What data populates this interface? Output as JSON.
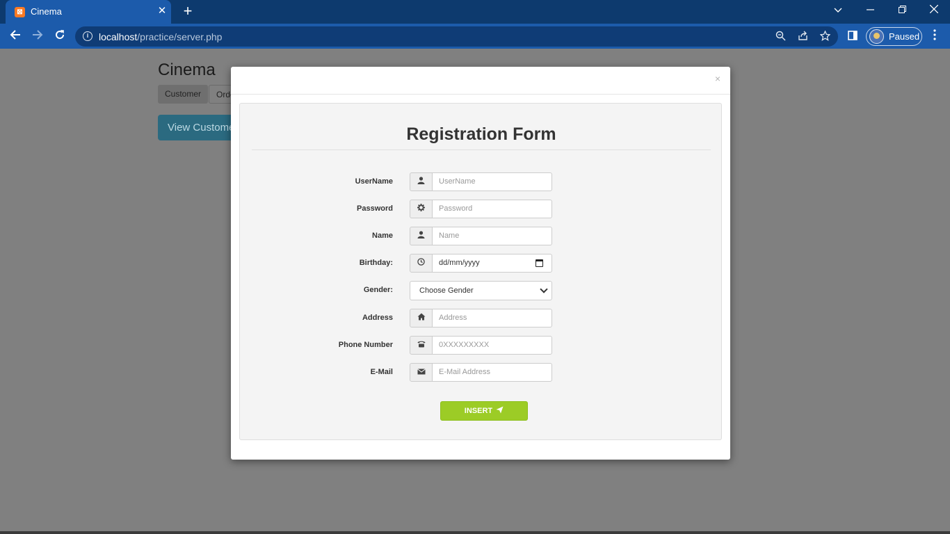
{
  "browser": {
    "tab_title": "Cinema",
    "tab_favicon": "xampp-favicon-icon",
    "url_host": "localhost",
    "url_path": "/practice/server.php",
    "profile_label": "Paused"
  },
  "page": {
    "brand": "Cinema",
    "tabs": [
      "Customer",
      "Orde"
    ],
    "view_button": "View Custome"
  },
  "modal": {
    "close_glyph": "×",
    "title": "Registration Form",
    "fields": {
      "username": {
        "label": "UserName",
        "placeholder": "UserName",
        "icon": "user-icon"
      },
      "password": {
        "label": "Password",
        "placeholder": "Password",
        "icon": "gear-icon"
      },
      "name": {
        "label": "Name",
        "placeholder": "Name",
        "icon": "user-icon"
      },
      "birthday": {
        "label": "Birthday:",
        "value": "dd/mm/yyyy",
        "icon": "clock-icon"
      },
      "gender": {
        "label": "Gender:",
        "selected": "Choose Gender"
      },
      "address": {
        "label": "Address",
        "placeholder": "Address",
        "icon": "home-icon"
      },
      "phone": {
        "label": "Phone Number",
        "placeholder": "0XXXXXXXXX",
        "icon": "phone-icon"
      },
      "email": {
        "label": "E-Mail",
        "placeholder": "E-Mail Address",
        "icon": "envelope-icon"
      }
    },
    "insert_label": "INSERT"
  },
  "colors": {
    "chrome_dark": "#0d3a6e",
    "chrome": "#1c5bab",
    "overlay": "#808080",
    "insert_button": "#9ccc26"
  }
}
